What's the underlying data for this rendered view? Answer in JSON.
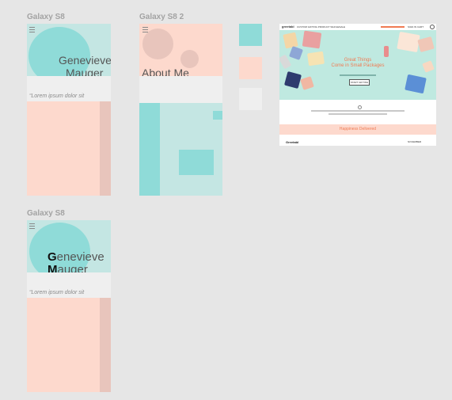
{
  "artboards": [
    {
      "title": "Galaxy S8",
      "name_line1": "Genevieve",
      "name_line2": "Mauger",
      "lorem": "Lorem ipsum dolor sit"
    },
    {
      "title": "Galaxy S8 2",
      "about": "About Me"
    },
    {
      "title": "Galaxy S8",
      "name_line1_initial": "G",
      "name_line1_rest": "enevieve",
      "name_line2_initial": "M",
      "name_line2_rest": "auger",
      "lorem": "Lorem ipsum dolor sit"
    }
  ],
  "swatches": [
    {
      "color": "#8fdbd8"
    },
    {
      "color": "#fdd9cd"
    },
    {
      "color": "#efefef"
    }
  ],
  "web_preview": {
    "logo": "greetabl",
    "nav": "CUSTOM GIFTING   PRODUCT   WHOLESALE",
    "nav_right": "SIGN IN   CART",
    "headline_1": "Great Things",
    "headline_2": "Come in Small Packages",
    "cta": "START GIFTING",
    "footer_band": "Happiness Delivered",
    "footer_logo": "Greetabl",
    "footer_right": "NOVEMBER"
  },
  "colors": {
    "mint": "#c4e6e3",
    "teal": "#8fdbd8",
    "peach": "#fdd9cd",
    "grey": "#efefef",
    "rose": "#e8c5bc",
    "coral": "#f07b53"
  }
}
